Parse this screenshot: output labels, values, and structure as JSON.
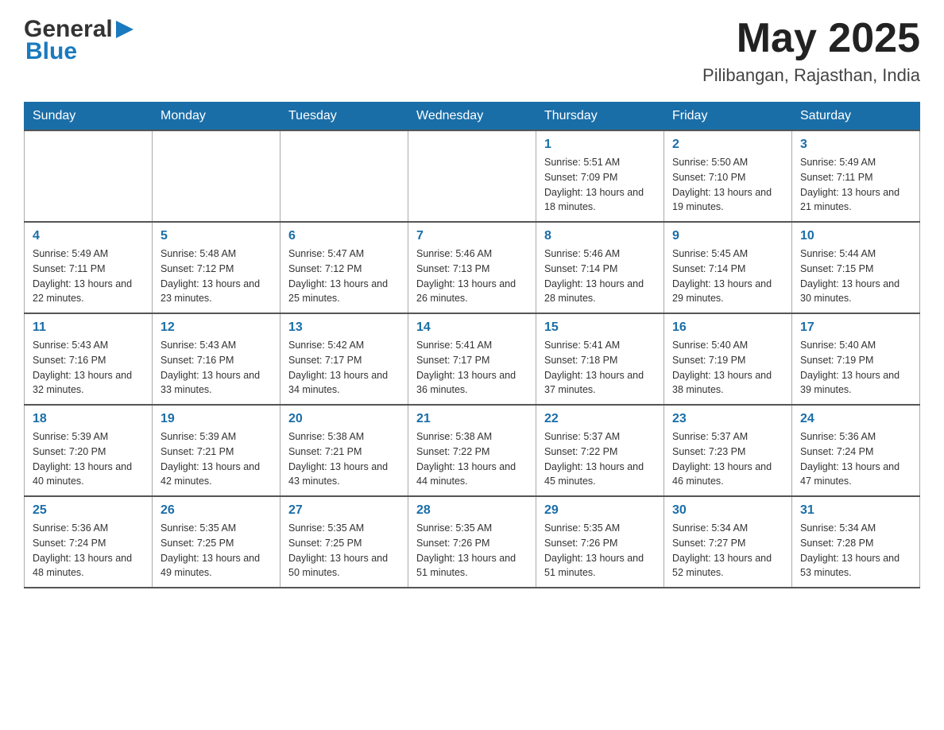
{
  "header": {
    "logo": {
      "general": "General",
      "arrow": "▶",
      "blue": "Blue"
    },
    "title": "May 2025",
    "location": "Pilibangan, Rajasthan, India"
  },
  "days_of_week": [
    "Sunday",
    "Monday",
    "Tuesday",
    "Wednesday",
    "Thursday",
    "Friday",
    "Saturday"
  ],
  "weeks": [
    [
      {
        "day": "",
        "info": ""
      },
      {
        "day": "",
        "info": ""
      },
      {
        "day": "",
        "info": ""
      },
      {
        "day": "",
        "info": ""
      },
      {
        "day": "1",
        "info": "Sunrise: 5:51 AM\nSunset: 7:09 PM\nDaylight: 13 hours and 18 minutes."
      },
      {
        "day": "2",
        "info": "Sunrise: 5:50 AM\nSunset: 7:10 PM\nDaylight: 13 hours and 19 minutes."
      },
      {
        "day": "3",
        "info": "Sunrise: 5:49 AM\nSunset: 7:11 PM\nDaylight: 13 hours and 21 minutes."
      }
    ],
    [
      {
        "day": "4",
        "info": "Sunrise: 5:49 AM\nSunset: 7:11 PM\nDaylight: 13 hours and 22 minutes."
      },
      {
        "day": "5",
        "info": "Sunrise: 5:48 AM\nSunset: 7:12 PM\nDaylight: 13 hours and 23 minutes."
      },
      {
        "day": "6",
        "info": "Sunrise: 5:47 AM\nSunset: 7:12 PM\nDaylight: 13 hours and 25 minutes."
      },
      {
        "day": "7",
        "info": "Sunrise: 5:46 AM\nSunset: 7:13 PM\nDaylight: 13 hours and 26 minutes."
      },
      {
        "day": "8",
        "info": "Sunrise: 5:46 AM\nSunset: 7:14 PM\nDaylight: 13 hours and 28 minutes."
      },
      {
        "day": "9",
        "info": "Sunrise: 5:45 AM\nSunset: 7:14 PM\nDaylight: 13 hours and 29 minutes."
      },
      {
        "day": "10",
        "info": "Sunrise: 5:44 AM\nSunset: 7:15 PM\nDaylight: 13 hours and 30 minutes."
      }
    ],
    [
      {
        "day": "11",
        "info": "Sunrise: 5:43 AM\nSunset: 7:16 PM\nDaylight: 13 hours and 32 minutes."
      },
      {
        "day": "12",
        "info": "Sunrise: 5:43 AM\nSunset: 7:16 PM\nDaylight: 13 hours and 33 minutes."
      },
      {
        "day": "13",
        "info": "Sunrise: 5:42 AM\nSunset: 7:17 PM\nDaylight: 13 hours and 34 minutes."
      },
      {
        "day": "14",
        "info": "Sunrise: 5:41 AM\nSunset: 7:17 PM\nDaylight: 13 hours and 36 minutes."
      },
      {
        "day": "15",
        "info": "Sunrise: 5:41 AM\nSunset: 7:18 PM\nDaylight: 13 hours and 37 minutes."
      },
      {
        "day": "16",
        "info": "Sunrise: 5:40 AM\nSunset: 7:19 PM\nDaylight: 13 hours and 38 minutes."
      },
      {
        "day": "17",
        "info": "Sunrise: 5:40 AM\nSunset: 7:19 PM\nDaylight: 13 hours and 39 minutes."
      }
    ],
    [
      {
        "day": "18",
        "info": "Sunrise: 5:39 AM\nSunset: 7:20 PM\nDaylight: 13 hours and 40 minutes."
      },
      {
        "day": "19",
        "info": "Sunrise: 5:39 AM\nSunset: 7:21 PM\nDaylight: 13 hours and 42 minutes."
      },
      {
        "day": "20",
        "info": "Sunrise: 5:38 AM\nSunset: 7:21 PM\nDaylight: 13 hours and 43 minutes."
      },
      {
        "day": "21",
        "info": "Sunrise: 5:38 AM\nSunset: 7:22 PM\nDaylight: 13 hours and 44 minutes."
      },
      {
        "day": "22",
        "info": "Sunrise: 5:37 AM\nSunset: 7:22 PM\nDaylight: 13 hours and 45 minutes."
      },
      {
        "day": "23",
        "info": "Sunrise: 5:37 AM\nSunset: 7:23 PM\nDaylight: 13 hours and 46 minutes."
      },
      {
        "day": "24",
        "info": "Sunrise: 5:36 AM\nSunset: 7:24 PM\nDaylight: 13 hours and 47 minutes."
      }
    ],
    [
      {
        "day": "25",
        "info": "Sunrise: 5:36 AM\nSunset: 7:24 PM\nDaylight: 13 hours and 48 minutes."
      },
      {
        "day": "26",
        "info": "Sunrise: 5:35 AM\nSunset: 7:25 PM\nDaylight: 13 hours and 49 minutes."
      },
      {
        "day": "27",
        "info": "Sunrise: 5:35 AM\nSunset: 7:25 PM\nDaylight: 13 hours and 50 minutes."
      },
      {
        "day": "28",
        "info": "Sunrise: 5:35 AM\nSunset: 7:26 PM\nDaylight: 13 hours and 51 minutes."
      },
      {
        "day": "29",
        "info": "Sunrise: 5:35 AM\nSunset: 7:26 PM\nDaylight: 13 hours and 51 minutes."
      },
      {
        "day": "30",
        "info": "Sunrise: 5:34 AM\nSunset: 7:27 PM\nDaylight: 13 hours and 52 minutes."
      },
      {
        "day": "31",
        "info": "Sunrise: 5:34 AM\nSunset: 7:28 PM\nDaylight: 13 hours and 53 minutes."
      }
    ]
  ]
}
